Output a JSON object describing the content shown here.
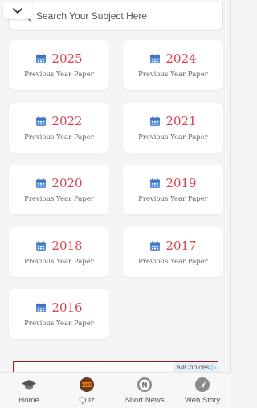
{
  "search": {
    "placeholder": "Search Your Subject Here"
  },
  "cards": [
    {
      "year": "2025",
      "subtitle": "Previous Year Paper"
    },
    {
      "year": "2024",
      "subtitle": "Previous Year Paper"
    },
    {
      "year": "2022",
      "subtitle": "Previous Year Paper"
    },
    {
      "year": "2021",
      "subtitle": "Previous Year Paper"
    },
    {
      "year": "2020",
      "subtitle": "Previous Year Paper"
    },
    {
      "year": "2019",
      "subtitle": "Previous Year Paper"
    },
    {
      "year": "2018",
      "subtitle": "Previous Year Paper"
    },
    {
      "year": "2017",
      "subtitle": "Previous Year Paper"
    },
    {
      "year": "2016",
      "subtitle": "Previous Year Paper"
    }
  ],
  "ad": {
    "choices_label": "AdChoices"
  },
  "bottom_nav": [
    {
      "label": "Home",
      "icon": "graduation-cap-icon"
    },
    {
      "label": "Quiz",
      "icon": "quiz-icon"
    },
    {
      "label": "Short News",
      "icon": "news-icon"
    },
    {
      "label": "Web Story",
      "icon": "web-story-icon"
    }
  ],
  "colors": {
    "year": "#d9444d",
    "calendar": "#5b8fd6",
    "background": "#f5f5f7"
  }
}
